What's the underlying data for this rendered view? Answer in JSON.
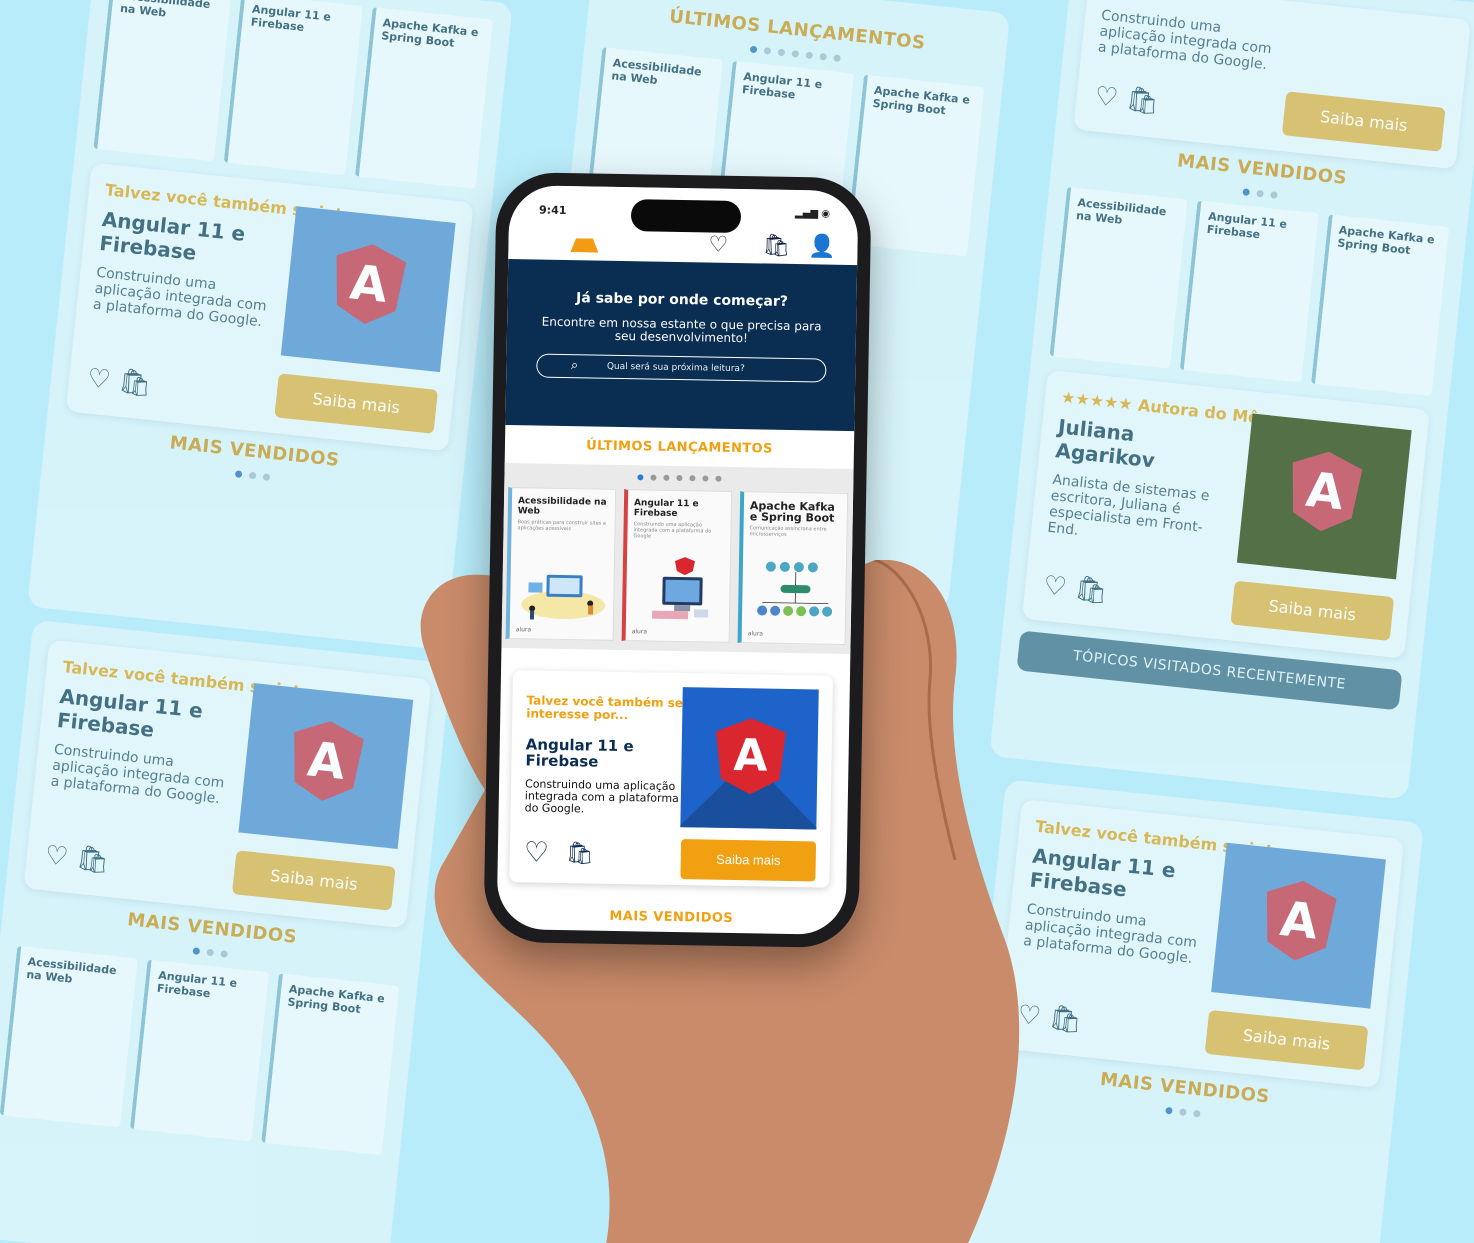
{
  "background": {
    "section_latest": "ÚLTIMOS LANÇAMENTOS",
    "section_best": "MAIS VENDIDOS",
    "kicker": "Talvez você também se interesse por...",
    "card_title": "Angular 11 e Firebase",
    "card_desc": "Construindo uma aplicação integrada com a plataforma do Google.",
    "card_cta": "Saiba mais",
    "book1": "Acessibilidade na Web",
    "book2": "Angular 11 e Firebase",
    "book3": "Apache Kafka e Spring Boot",
    "author_kicker": "Autora do Mês",
    "author_name": "Juliana Agarikov",
    "author_desc": "Analista de sistemas e escritora, Juliana é especialista em Front-End.",
    "recent_topics": "TÓPICOS VISITADOS RECENTEMENTE"
  },
  "phone": {
    "status_time": "9:41",
    "hero_title": "Já sabe por onde começar?",
    "hero_text": "Encontre em nossa estante o que precisa para seu desenvolvimento!",
    "search_placeholder": "Qual será sua próxima leitura?",
    "latest_title": "ÚLTIMOS LANÇAMENTOS",
    "books": [
      {
        "title": "Acessibilidade na Web",
        "subtitle": "Boas práticas para construir sites e aplicações acessíveis",
        "brand": "alura"
      },
      {
        "title": "Angular 11 e Firebase",
        "subtitle": "Construindo uma aplicação integrada com a plataforma do Google",
        "brand": "alura"
      },
      {
        "title": "Apache Kafka e Spring Boot",
        "subtitle": "Comunicação assíncrona entre microsserviços",
        "brand": "alura"
      }
    ],
    "rec_kicker": "Talvez você também se interesse por...",
    "rec_title": "Angular 11 e Firebase",
    "rec_desc": "Construindo uma aplicação integrada com a plataforma do Google.",
    "rec_cta": "Saiba mais",
    "best_title": "MAIS VENDIDOS",
    "angular_letter": "A"
  },
  "colors": {
    "brand_orange": "#f0a010",
    "navy": "#0a2d52",
    "background": "#b9ecfa"
  }
}
